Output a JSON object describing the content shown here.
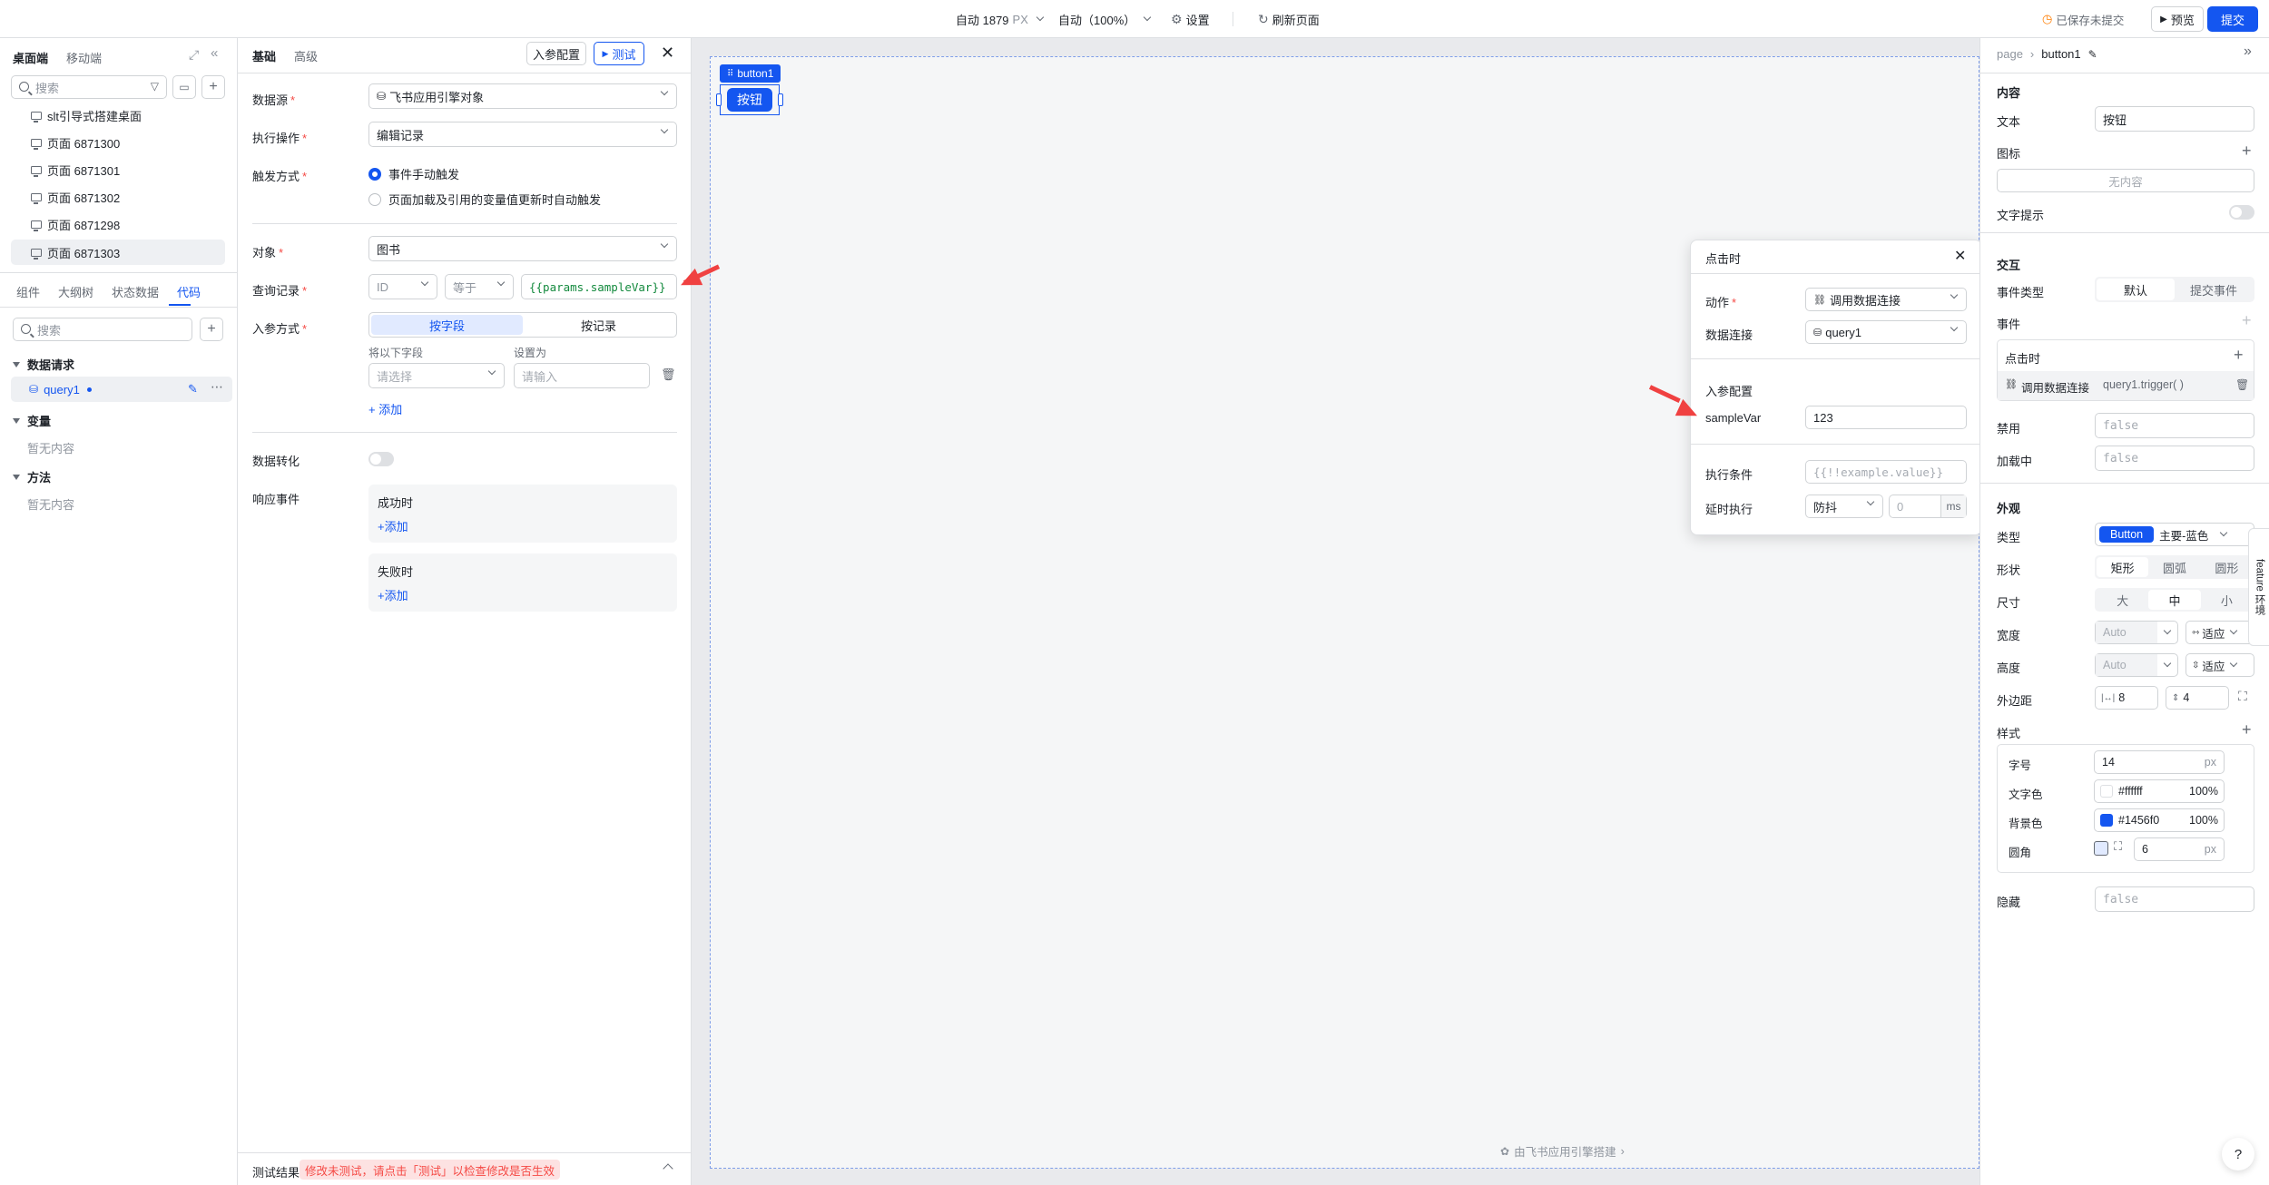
{
  "topbar": {
    "canvas_width": "自动 1879",
    "canvas_width_unit": "PX",
    "zoom": "自动（100%）",
    "settings": "设置",
    "refresh": "刷新页面",
    "save_status": "已保存未提交",
    "preview": "预览",
    "submit": "提交"
  },
  "left": {
    "tabs": [
      "桌面端",
      "移动端"
    ],
    "search_placeholder": "搜索",
    "pages": [
      "slt引导式搭建桌面",
      "页面 6871300",
      "页面 6871301",
      "页面 6871302",
      "页面 6871298",
      "页面 6871303"
    ],
    "bottom_tabs": [
      "组件",
      "大纲树",
      "状态数据",
      "代码"
    ],
    "code_search_placeholder": "搜索",
    "sections": {
      "data_request": "数据请求",
      "query": "query1",
      "variables": "变量",
      "variables_empty": "暂无内容",
      "methods": "方法",
      "methods_empty": "暂无内容"
    }
  },
  "config": {
    "tabs": [
      "基础",
      "高级"
    ],
    "param_config_btn": "入参配置",
    "test_btn": "测试",
    "datasource_label": "数据源",
    "datasource_value": "飞书应用引擎对象",
    "operation_label": "执行操作",
    "operation_value": "编辑记录",
    "trigger_label": "触发方式",
    "trigger_opt1": "事件手动触发",
    "trigger_opt2": "页面加载及引用的变量值更新时自动触发",
    "object_label": "对象",
    "object_value": "图书",
    "query_label": "查询记录",
    "query_field": "ID",
    "query_op": "等于",
    "query_value": "{{params.sampleVar}}",
    "param_mode_label": "入参方式",
    "param_mode_opt1": "按字段",
    "param_mode_opt2": "按记录",
    "field_col": "将以下字段",
    "setas_col": "设置为",
    "field_placeholder": "请选择",
    "value_placeholder": "请输入",
    "add": "添加",
    "transform_label": "数据转化",
    "response_label": "响应事件",
    "on_success": "成功时",
    "on_fail": "失败时",
    "add_success": "添加",
    "add_fail": "添加",
    "test_result_label": "测试结果",
    "test_result_warning": "修改未测试，请点击「测试」以检查修改是否生效"
  },
  "canvas": {
    "selected_tag": "button1",
    "button_text": "按钮",
    "footer": "由飞书应用引擎搭建"
  },
  "popup": {
    "title": "点击时",
    "action_label": "动作",
    "action_value": "调用数据连接",
    "connection_label": "数据连接",
    "connection_value": "query1",
    "param_section": "入参配置",
    "param_name": "sampleVar",
    "param_value": "123",
    "condition_label": "执行条件",
    "condition_placeholder": "{{!!example.value}}",
    "delay_label": "延时执行",
    "delay_mode": "防抖",
    "delay_placeholder": "0",
    "delay_unit": "ms"
  },
  "right": {
    "breadcrumb_root": "page",
    "breadcrumb_current": "button1",
    "content_section": "内容",
    "text_label": "文本",
    "text_value": "按钮",
    "icon_label": "图标",
    "icon_empty": "无内容",
    "tooltip_label": "文字提示",
    "interaction_section": "交互",
    "event_type_label": "事件类型",
    "event_type_opt1": "默认",
    "event_type_opt2": "提交事件",
    "events_label": "事件",
    "on_click": "点击时",
    "event_action": "调用数据连接",
    "event_code": "query1.trigger( )",
    "disabled_label": "禁用",
    "disabled_value": "false",
    "loading_label": "加载中",
    "loading_value": "false",
    "appearance_section": "外观",
    "type_label": "类型",
    "type_value": "Button",
    "type_variant": "主要-蓝色",
    "shape_label": "形状",
    "shape_opts": [
      "矩形",
      "圆弧",
      "圆形"
    ],
    "size_label": "尺寸",
    "size_opts": [
      "大",
      "中",
      "小"
    ],
    "width_label": "宽度",
    "width_value": "Auto",
    "width_mode": "适应",
    "height_label": "高度",
    "height_value": "Auto",
    "height_mode": "适应",
    "margin_label": "外边距",
    "margin_h": "8",
    "margin_v": "4",
    "style_section": "样式",
    "font_size_label": "字号",
    "font_size_value": "14",
    "font_size_unit": "px",
    "text_color_label": "文字色",
    "text_color_value": "#ffffff",
    "text_color_opacity": "100%",
    "bg_color_label": "背景色",
    "bg_color_value": "#1456f0",
    "bg_color_opacity": "100%",
    "radius_label": "圆角",
    "radius_value": "6",
    "radius_unit": "px",
    "hidden_label": "隐藏",
    "hidden_value": "false",
    "side_tab": "feature 环境"
  },
  "colors": {
    "accent": "#1456f0",
    "danger": "#f54a45",
    "arrow": "#f04141"
  }
}
